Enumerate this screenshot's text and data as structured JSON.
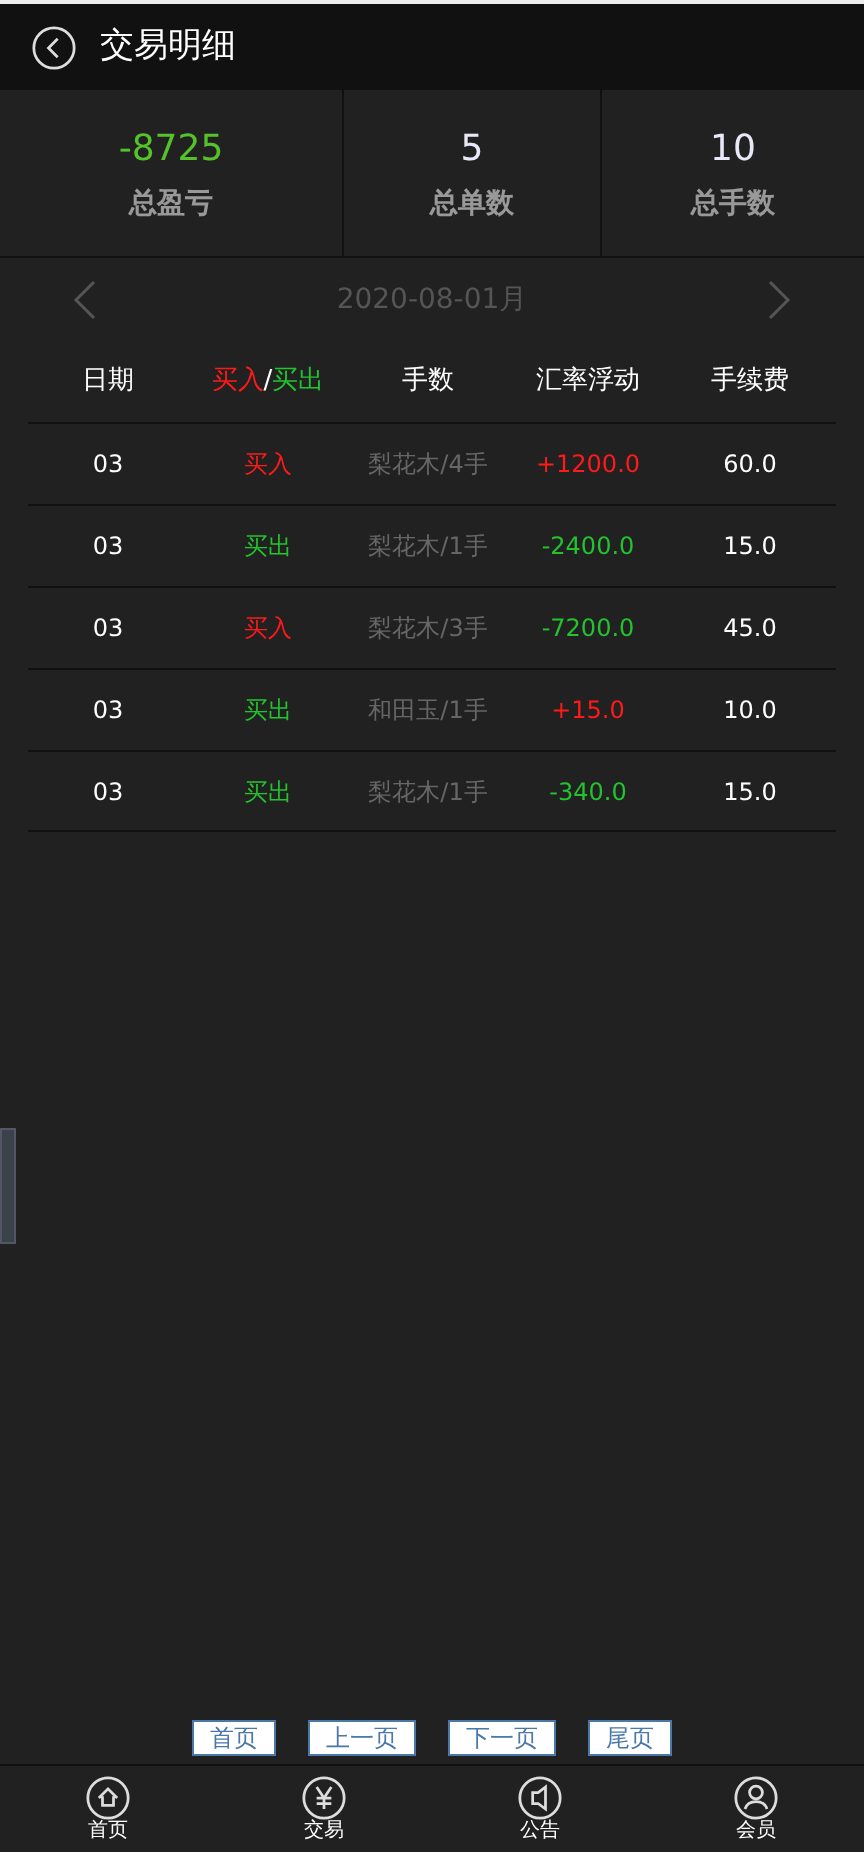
{
  "header": {
    "title": "交易明细"
  },
  "stats": [
    {
      "value": "-8725",
      "label": "总盈亏",
      "color": "#56c22a"
    },
    {
      "value": "5",
      "label": "总单数",
      "color": "#e8e8f8"
    },
    {
      "value": "10",
      "label": "总手数",
      "color": "#e8e8f8"
    }
  ],
  "date_nav": {
    "date": "2020-08-01月"
  },
  "table": {
    "columns": [
      {
        "parts": [
          {
            "text": "日期",
            "color": "#ffffff"
          }
        ]
      },
      {
        "parts": [
          {
            "text": "买入",
            "color": "#ff1a1a"
          },
          {
            "text": "/",
            "color": "#ffffff"
          },
          {
            "text": "买出",
            "color": "#22c32e"
          }
        ]
      },
      {
        "parts": [
          {
            "text": "手数",
            "color": "#ffffff"
          }
        ]
      },
      {
        "parts": [
          {
            "text": "汇率浮动",
            "color": "#ffffff"
          }
        ]
      },
      {
        "parts": [
          {
            "text": "手续费",
            "color": "#ffffff"
          }
        ]
      }
    ],
    "rows": [
      {
        "date": "03",
        "side": {
          "text": "买入",
          "color": "#ff1a1a"
        },
        "product": "梨花木/4手",
        "change": {
          "text": "+1200.0",
          "color": "#ff1a1a"
        },
        "fee": "60.0"
      },
      {
        "date": "03",
        "side": {
          "text": "买出",
          "color": "#22c32e"
        },
        "product": "梨花木/1手",
        "change": {
          "text": "-2400.0",
          "color": "#22c32e"
        },
        "fee": "15.0"
      },
      {
        "date": "03",
        "side": {
          "text": "买入",
          "color": "#ff1a1a"
        },
        "product": "梨花木/3手",
        "change": {
          "text": "-7200.0",
          "color": "#22c32e"
        },
        "fee": "45.0"
      },
      {
        "date": "03",
        "side": {
          "text": "买出",
          "color": "#22c32e"
        },
        "product": "和田玉/1手",
        "change": {
          "text": "+15.0",
          "color": "#ff1a1a"
        },
        "fee": "10.0"
      },
      {
        "date": "03",
        "side": {
          "text": "买出",
          "color": "#22c32e"
        },
        "product": "梨花木/1手",
        "change": {
          "text": "-340.0",
          "color": "#22c32e"
        },
        "fee": "15.0"
      }
    ]
  },
  "pager": [
    "首页",
    "上一页",
    "下一页",
    "尾页"
  ],
  "tab_bar": [
    {
      "label": "首页"
    },
    {
      "label": "交易"
    },
    {
      "label": "公告"
    },
    {
      "label": "会员"
    }
  ]
}
